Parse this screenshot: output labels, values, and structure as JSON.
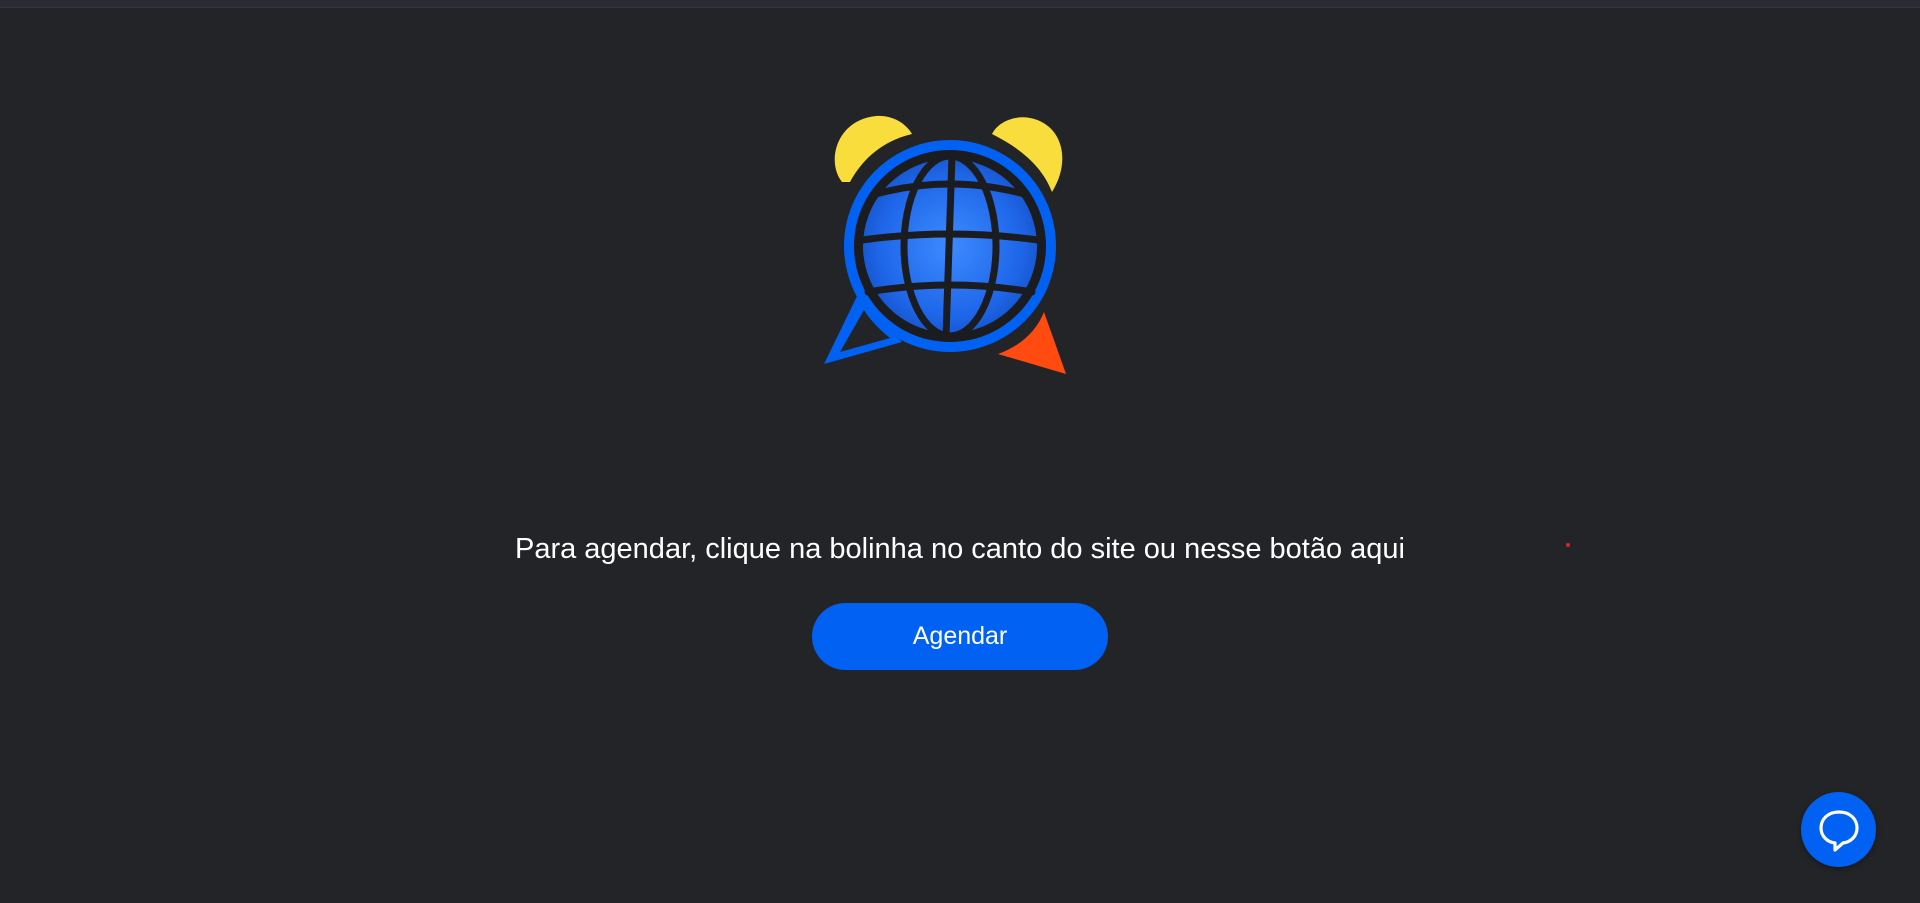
{
  "page": {
    "message": "Para agendar, clique na bolinha no canto do site ou nesse botão aqui",
    "schedule_button_label": "Agendar"
  },
  "icons": {
    "logo": "alarm-clock-globe-logo",
    "chat": "chat-bubble-icon"
  },
  "colors": {
    "background": "#232427",
    "accent": "#0061f2",
    "text": "#ffffff",
    "bell": "#f8dd3c",
    "pointer": "#ff4b10"
  }
}
